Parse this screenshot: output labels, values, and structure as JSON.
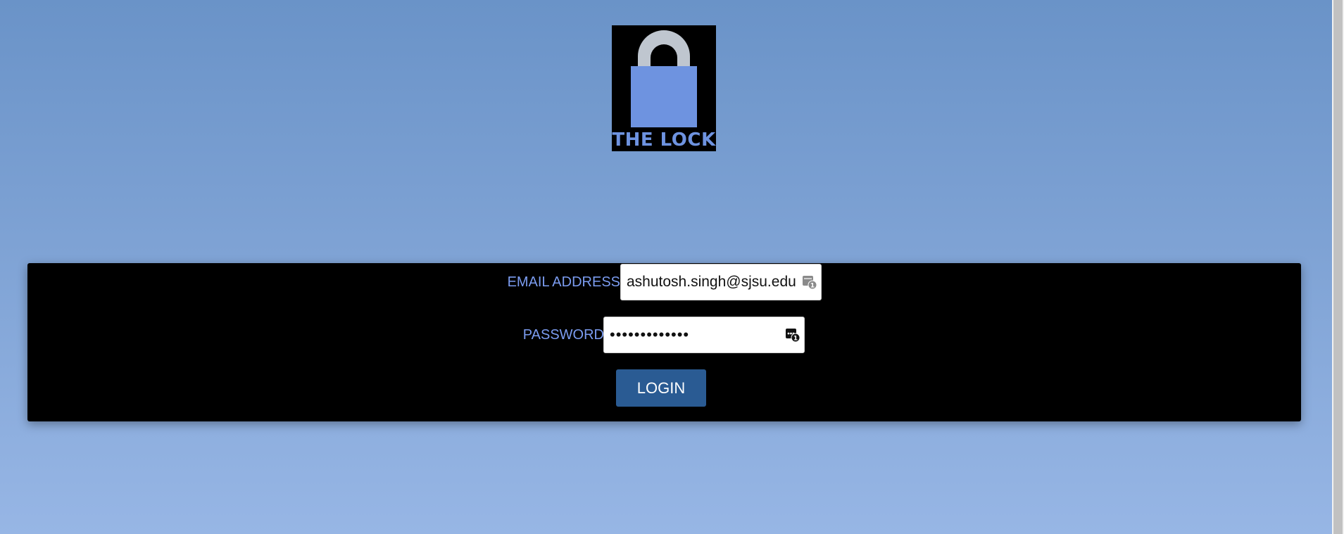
{
  "logo": {
    "text": "THE LOCK",
    "icon": "padlock-icon"
  },
  "form": {
    "email": {
      "label": "EMAIL ADDRESS",
      "value": "ashutosh.singh@sjsu.edu"
    },
    "password": {
      "label": "PASSWORD",
      "value": "•••••••••••••"
    },
    "login_button": "LOGIN"
  },
  "colors": {
    "background_top": "#6a93c8",
    "background_bottom": "#97b6e5",
    "panel": "#000000",
    "label_text": "#7b9cf0",
    "button": "#2a5b93",
    "lock_body": "#6e93e0",
    "lock_shackle": "#bfc6cf"
  }
}
